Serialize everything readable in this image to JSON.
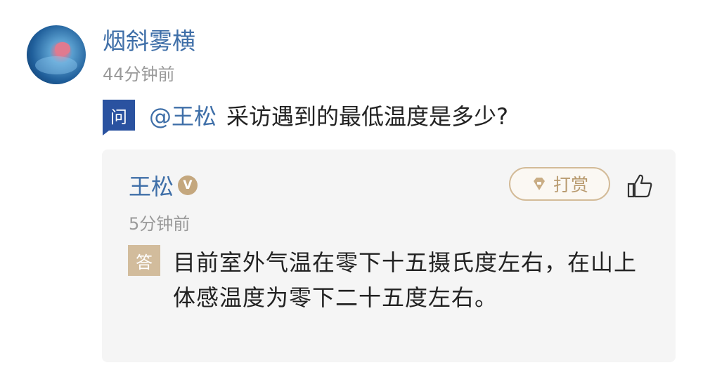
{
  "comment": {
    "username": "烟斜雾横",
    "time": "44分钟前",
    "question_badge": "问",
    "mention": "@王松",
    "question": "采访遇到的最低温度是多少?"
  },
  "answer": {
    "name": "王松",
    "verified_badge": "V",
    "tip_label": "打赏",
    "time": "5分钟前",
    "answer_badge": "答",
    "text": "目前室外气温在零下十五摄氏度左右，在山上体感温度为零下二十五度左右。"
  },
  "colors": {
    "link_blue": "#3f6fa8",
    "question_badge": "#2a52a0",
    "answer_badge": "#d2bc9c",
    "gold": "#c4a77e",
    "card_background": "#f5f5f5"
  },
  "icons": {
    "avatar": "jellyfish-avatar",
    "verified": "verified-v-icon",
    "tip": "gem-icon",
    "like": "thumbs-up-icon"
  }
}
